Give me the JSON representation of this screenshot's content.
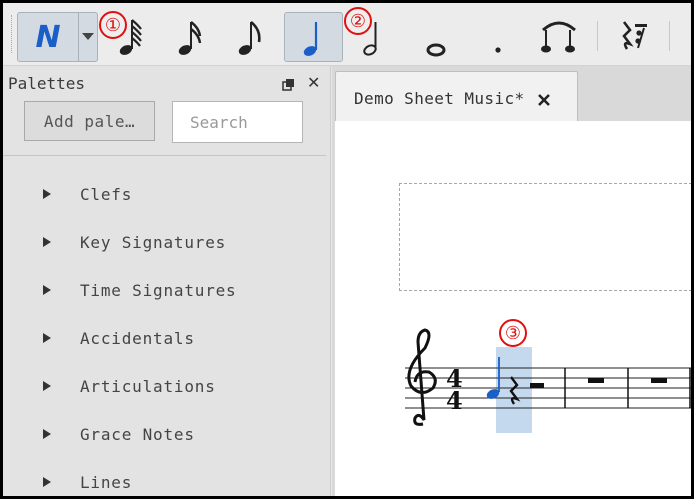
{
  "toolbar": {
    "note_input_mode": "N",
    "durations": [
      {
        "name": "64th-note",
        "icon": "sixty-fourth-note-icon"
      },
      {
        "name": "16th-note",
        "icon": "sixteenth-note-icon"
      },
      {
        "name": "8th-note",
        "icon": "eighth-note-icon"
      },
      {
        "name": "quarter-note",
        "icon": "quarter-note-icon",
        "active": true
      },
      {
        "name": "half-note",
        "icon": "half-note-icon"
      },
      {
        "name": "whole-note",
        "icon": "whole-note-icon"
      },
      {
        "name": "augmentation-dot",
        "icon": "augmentation-dot-icon"
      }
    ],
    "tie_icon": "tie-icon",
    "rest_icon": "rest-icon",
    "accent_color": "#1a5fc8"
  },
  "callouts": [
    "①",
    "②",
    "③"
  ],
  "palettes": {
    "title": "Palettes",
    "add_button": "Add pale…",
    "search_placeholder": "Search",
    "items": [
      "Clefs",
      "Key Signatures",
      "Time Signatures",
      "Accidentals",
      "Articulations",
      "Grace Notes",
      "Lines"
    ]
  },
  "document": {
    "tab_title": "Demo Sheet Music*",
    "time_signature": {
      "top": "4",
      "bottom": "4"
    },
    "selection_color": "#c5d9ee"
  }
}
